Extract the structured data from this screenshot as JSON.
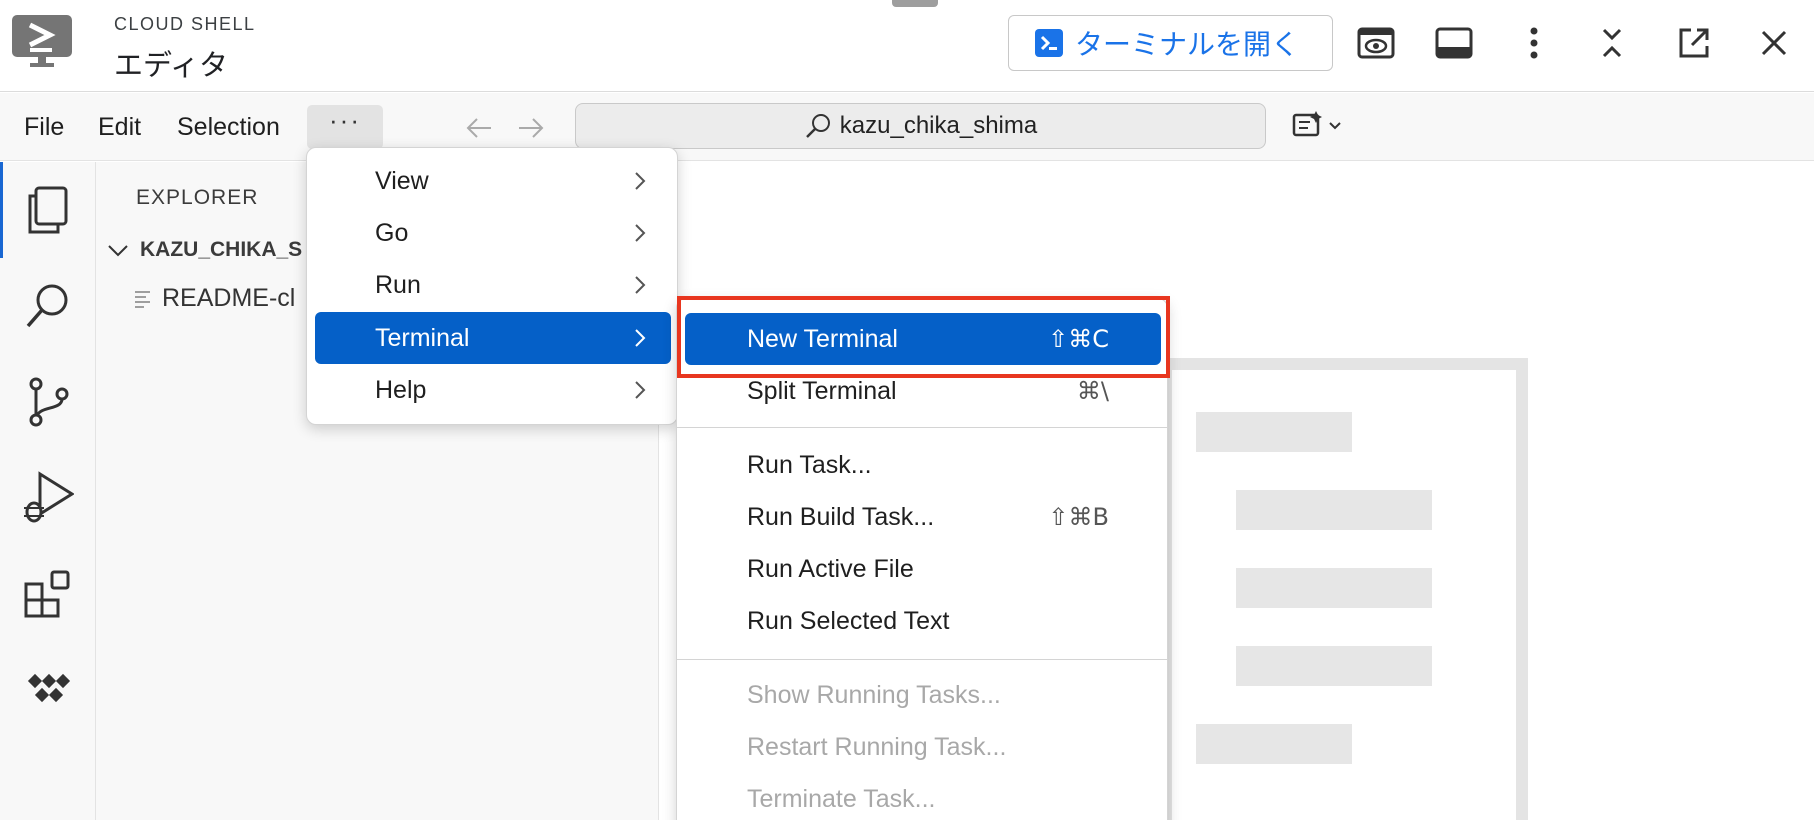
{
  "cloud_shell": {
    "brand": "CLOUD SHELL",
    "title": "エディタ",
    "open_terminal_label": "ターミナルを開く"
  },
  "menubar": {
    "file": "File",
    "edit": "Edit",
    "selection": "Selection",
    "more": "···",
    "search_text": "kazu_chika_shima"
  },
  "explorer": {
    "title": "EXPLORER",
    "folder": "KAZU_CHIKA_S",
    "file": "README-cl"
  },
  "main_menu": {
    "items": [
      {
        "label": "View"
      },
      {
        "label": "Go"
      },
      {
        "label": "Run"
      },
      {
        "label": "Terminal"
      },
      {
        "label": "Help"
      }
    ]
  },
  "terminal_menu": {
    "items": [
      {
        "label": "New Terminal",
        "shortcut": "⇧⌘C"
      },
      {
        "label": "Split Terminal",
        "shortcut": "⌘\\"
      },
      {
        "label": "Run Task..."
      },
      {
        "label": "Run Build Task...",
        "shortcut": "⇧⌘B"
      },
      {
        "label": "Run Active File"
      },
      {
        "label": "Run Selected Text"
      },
      {
        "label": "Show Running Tasks..."
      },
      {
        "label": "Restart Running Task..."
      },
      {
        "label": "Terminate Task..."
      }
    ]
  },
  "colors": {
    "accent": "#0560c8",
    "link_blue": "#1a73e8",
    "highlight_red": "#e8361f"
  }
}
